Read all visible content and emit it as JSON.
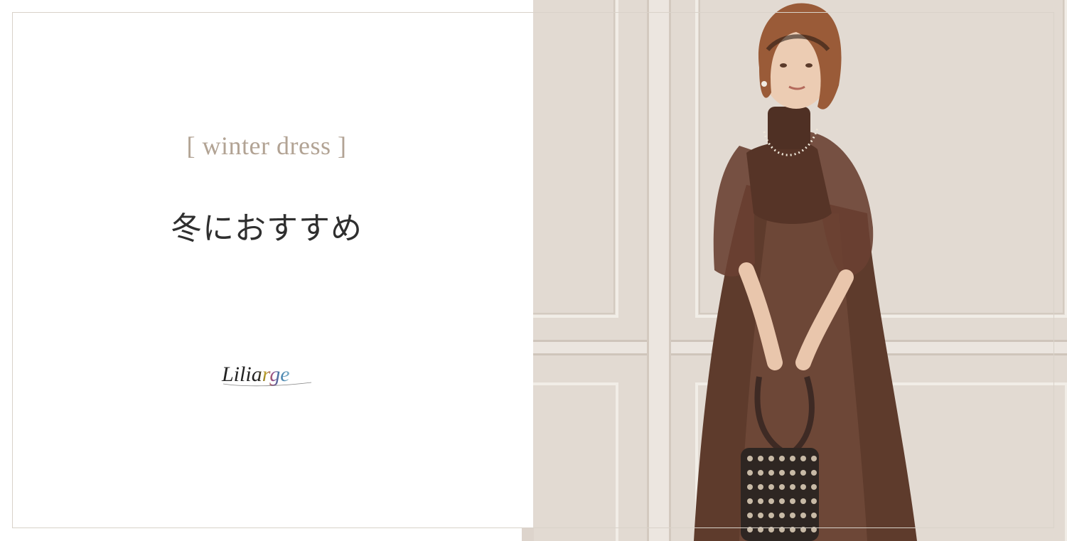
{
  "banner": {
    "eyebrow": "[ winter dress ]",
    "heading": "冬におすすめ",
    "brand": "Liliarge"
  },
  "photo": {
    "subject": "model-in-brown-sheer-dress",
    "colors": {
      "wall": "#e4ddd6",
      "molding": "#f1ece7",
      "dress": "#5b3a2c",
      "hair": "#9a5d3a",
      "skin": "#ebcbb2"
    }
  },
  "colors": {
    "eyebrow": "#b2a394",
    "heading": "#2f2f2f",
    "frame": "#d9d2c9"
  }
}
